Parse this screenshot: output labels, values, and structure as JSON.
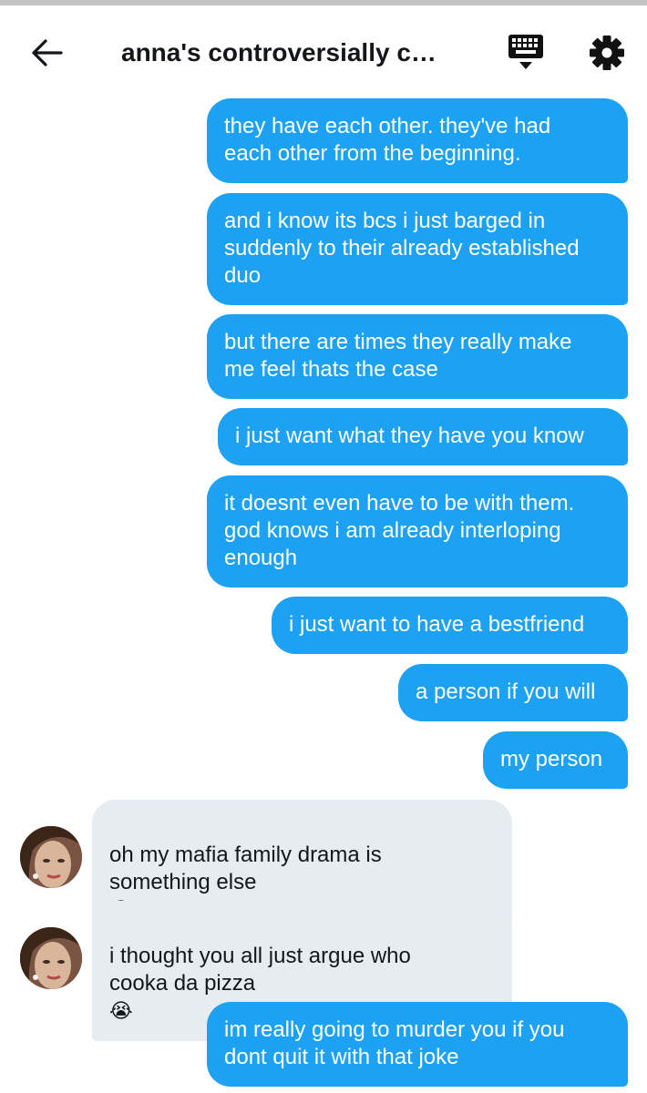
{
  "header": {
    "title": "anna's controversially cat...",
    "back_icon": "arrow-left-icon",
    "keyboard_icon": "keyboard-icon",
    "settings_icon": "gear-icon"
  },
  "colors": {
    "outgoing_bubble": "#1da1f2",
    "incoming_bubble": "#e6ecf0",
    "text_dark": "#14171a"
  },
  "messages": [
    {
      "direction": "out",
      "text": "they have each other. they've had\neach other from the beginning."
    },
    {
      "direction": "out",
      "text": "and i know its bcs i just barged in\nsuddenly to their already established\nduo"
    },
    {
      "direction": "out",
      "text": "but there are times they really make\nme feel thats the case"
    },
    {
      "direction": "out",
      "text": "i just want what they have you know"
    },
    {
      "direction": "out",
      "text": "it doesnt even have to be with them.\ngod knows i am already interloping\nenough"
    },
    {
      "direction": "out",
      "text": "i just want to have a bestfriend"
    },
    {
      "direction": "out",
      "text": "a person if you will"
    },
    {
      "direction": "out",
      "text": "my person"
    },
    {
      "direction": "in",
      "text": "oh my mafia family drama is\nsomething else",
      "emoji": "😭"
    },
    {
      "direction": "in",
      "text": "i thought you all just argue who\ncooka da pizza",
      "emoji": "😭"
    },
    {
      "direction": "out",
      "text": "im really going to murder you if you\ndont quit it with that joke"
    }
  ]
}
